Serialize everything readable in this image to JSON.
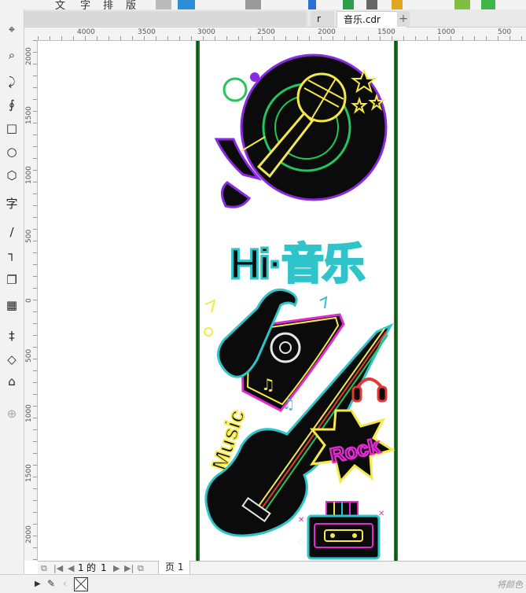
{
  "top_toolbar": {
    "glyphs": [
      "文",
      "字",
      "排",
      "版"
    ]
  },
  "tabs": {
    "prev_tab_label": "r",
    "active_tab_label": "音乐.cdr",
    "add_tab_label": "+"
  },
  "ruler": {
    "horizontal_labels": [
      "4000",
      "3500",
      "3000",
      "2500",
      "2000",
      "1500",
      "1000",
      "500"
    ],
    "vertical_labels": [
      "2000",
      "1500",
      "1000",
      "500",
      "0",
      "500",
      "1000",
      "1500",
      "2000"
    ]
  },
  "toolbox": {
    "tools": [
      {
        "name": "crop-tool",
        "glyph": "⌖"
      },
      {
        "name": "zoom-tool",
        "glyph": "⌕"
      },
      {
        "name": "freehand-tool",
        "glyph": "⤸"
      },
      {
        "name": "bezier-tool",
        "glyph": "∮"
      },
      {
        "name": "rectangle-tool",
        "glyph": "□"
      },
      {
        "name": "ellipse-tool",
        "glyph": "○"
      },
      {
        "name": "polygon-tool",
        "glyph": "⬡"
      },
      {
        "name": "text-tool",
        "glyph": "字"
      },
      {
        "name": "parallel-dimension-tool",
        "glyph": "∕"
      },
      {
        "name": "connector-tool",
        "glyph": "┐"
      },
      {
        "name": "drop-shadow-tool",
        "glyph": "❐"
      },
      {
        "name": "transparency-tool",
        "glyph": "▦"
      },
      {
        "name": "eyedropper-tool",
        "glyph": "‡"
      },
      {
        "name": "interactive-fill-tool",
        "glyph": "◇"
      },
      {
        "name": "smart-fill-tool",
        "glyph": "⌂"
      },
      {
        "name": "add-tool",
        "glyph": "⊕"
      }
    ]
  },
  "page_nav": {
    "current": "1",
    "of_label": "的",
    "total": "1",
    "page_tab_label": "页 1"
  },
  "statusbar": {
    "hint": "将颜色"
  },
  "poster": {
    "headline": "Hi·音乐",
    "rock": "Rock",
    "music": "Music",
    "colors": {
      "neon_purple": "#8a2be2",
      "neon_green": "#22c55e",
      "neon_cyan": "#2ec4c9",
      "neon_yellow": "#f5e94a",
      "neon_magenta": "#e12bd0",
      "neon_red": "#e53935",
      "ink": "#0b0b0b",
      "frame_green": "#1f7a2a"
    }
  }
}
